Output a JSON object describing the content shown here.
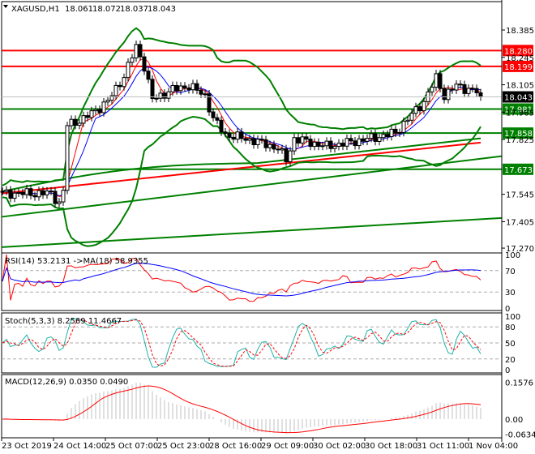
{
  "header": {
    "symbol": "XAGUSD,H1",
    "open": "18.061",
    "high": "18.072",
    "low": "18.037",
    "close": "18.043"
  },
  "chart_data": {
    "type": "candlestick",
    "price_axis": {
      "min": 17.27,
      "max": 18.385,
      "ticks": [
        "18.385",
        "18.245",
        "18.105",
        "17.965",
        "17.825",
        "17.545",
        "17.405",
        "17.270"
      ]
    },
    "current_price": "18.043",
    "levels": [
      {
        "value": "18.280",
        "color": "#ff0000"
      },
      {
        "value": "18.199",
        "color": "#ff0000"
      },
      {
        "value": "17.981",
        "color": "#008000"
      },
      {
        "value": "17.858",
        "color": "#008000"
      },
      {
        "value": "17.673",
        "color": "#008000"
      }
    ],
    "trendlines": [
      {
        "from": 17.275,
        "to": 17.424
      },
      {
        "from": 17.43,
        "to": 17.74
      }
    ],
    "price_keypoints": [
      [
        0,
        17.55
      ],
      [
        12,
        17.55
      ],
      [
        14,
        17.5
      ],
      [
        15,
        17.56
      ],
      [
        16,
        17.9
      ],
      [
        20,
        17.93
      ],
      [
        26,
        18.02
      ],
      [
        30,
        18.15
      ],
      [
        33,
        18.3
      ],
      [
        35,
        18.2
      ],
      [
        37,
        18.03
      ],
      [
        42,
        18.08
      ],
      [
        46,
        18.1
      ],
      [
        50,
        18.05
      ],
      [
        52,
        17.93
      ],
      [
        55,
        17.85
      ],
      [
        62,
        17.82
      ],
      [
        68,
        17.78
      ],
      [
        70,
        17.72
      ],
      [
        72,
        17.83
      ],
      [
        80,
        17.79
      ],
      [
        88,
        17.82
      ],
      [
        93,
        17.84
      ],
      [
        97,
        17.86
      ],
      [
        100,
        17.93
      ],
      [
        104,
        18.02
      ],
      [
        107,
        18.14
      ],
      [
        109,
        18.05
      ],
      [
        112,
        18.1
      ],
      [
        117,
        18.07
      ],
      [
        118,
        18.043
      ]
    ],
    "time_labels": [
      "23 Oct 2019",
      "24 Oct 14:00",
      "25 Oct 07:00",
      "25 Oct 23:00",
      "28 Oct 16:00",
      "29 Oct 09:00",
      "30 Oct 02:00",
      "30 Oct 18:00",
      "31 Oct 11:00",
      "1 Nov 04:00"
    ],
    "rsi": {
      "label": "RSI(14) 53.2131  ->MA(18) 58.9355",
      "ticks": [
        "100",
        "70",
        "30",
        "0"
      ]
    },
    "stoch": {
      "label": "Stoch(5,3,3) 8.2569 11.4667",
      "ticks": [
        "100",
        "80",
        "50",
        "20",
        "0"
      ]
    },
    "macd": {
      "label": "MACD(12,26,9) 0.0350 0.0490",
      "ticks": [
        "0.1576",
        "0.00",
        "-0.0634"
      ]
    }
  },
  "colors": {
    "up": "#000000",
    "down": "#000000",
    "band": "#008000",
    "ma200": "#ff0000"
  }
}
